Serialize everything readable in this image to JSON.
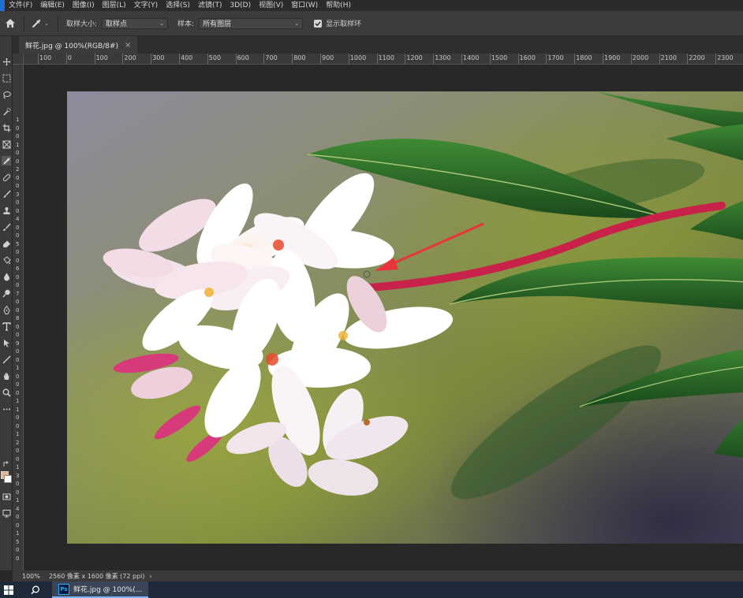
{
  "menubar": {
    "items": [
      "文件(F)",
      "编辑(E)",
      "图像(I)",
      "图层(L)",
      "文字(Y)",
      "选择(S)",
      "滤镜(T)",
      "3D(D)",
      "视图(V)",
      "窗口(W)",
      "帮助(H)"
    ]
  },
  "options": {
    "sample_size_label": "取样大小:",
    "sample_size_value": "取样点",
    "sample_label": "样本:",
    "sample_value": "所有图层",
    "show_ring_label": "显示取样环",
    "show_ring_checked": true
  },
  "tab": {
    "title": "鲜花.jpg @ 100%(RGB/8#)",
    "close": "×"
  },
  "ruler": {
    "labels": [
      "100",
      "0",
      "100",
      "200",
      "300",
      "400",
      "500",
      "600",
      "700",
      "800",
      "900",
      "1000",
      "1100",
      "1200",
      "1300",
      "1400",
      "1500",
      "1600",
      "1700",
      "1800",
      "1900",
      "2000",
      "2100",
      "2200",
      "2300"
    ],
    "vertical_digits": [
      "1",
      "0",
      "0",
      "1",
      "0",
      "0",
      "2",
      "0",
      "0",
      "3",
      "0",
      "0",
      "4",
      "0",
      "0",
      "5",
      "0",
      "0",
      "6",
      "0",
      "0",
      "7",
      "0",
      "0",
      "8",
      "0",
      "0",
      "9",
      "0",
      "0",
      "1",
      "0",
      "0",
      "0",
      "1",
      "1",
      "0",
      "0",
      "1",
      "2",
      "0",
      "0",
      "1",
      "3",
      "0",
      "0",
      "1",
      "4",
      "0",
      "0",
      "1",
      "5",
      "0",
      "0"
    ]
  },
  "status": {
    "zoom": "100%",
    "doc_info": "2560 像素 x 1600 像素 (72 ppi)",
    "arrow": "›"
  },
  "taskbar": {
    "ps_label": "Ps",
    "app_title": "鲜花.jpg @ 100%(..."
  },
  "colors": {
    "foreground": "#e1b796",
    "background": "#ffffff",
    "annotation_arrow": "#e8343a"
  },
  "tools": [
    "move-icon",
    "marquee-icon",
    "lasso-icon",
    "quick-select-icon",
    "crop-icon",
    "frame-icon",
    "eyedropper-icon",
    "healing-icon",
    "brush-icon",
    "stamp-icon",
    "history-brush-icon",
    "eraser-icon",
    "gradient-icon",
    "blur-icon",
    "dodge-icon",
    "pen-icon",
    "type-icon",
    "path-select-icon",
    "line-icon",
    "hand-icon",
    "zoom-icon",
    "more-icon",
    "swap-icon"
  ]
}
